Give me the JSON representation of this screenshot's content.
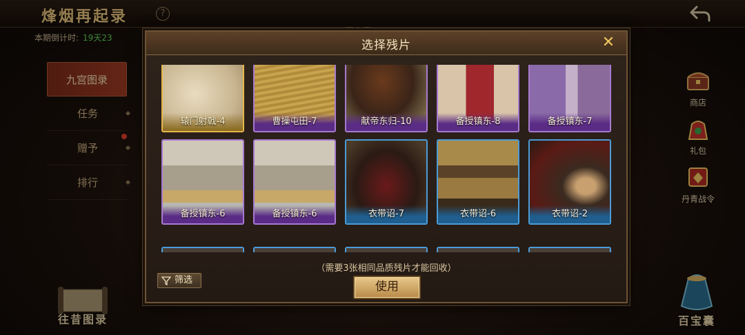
{
  "background": {
    "title": "烽烟再起录",
    "countdown_label": "本期倒计时:",
    "countdown_value": "19天23",
    "under_tab": "百宝囊",
    "nav": [
      {
        "label": "九宫图录",
        "active": true
      },
      {
        "label": "任务",
        "active": false
      },
      {
        "label": "赠予",
        "active": false,
        "notify": true
      },
      {
        "label": "排行",
        "active": false
      }
    ],
    "rail": [
      {
        "label": "商店",
        "icon": "shop-chest-icon"
      },
      {
        "label": "礼包",
        "icon": "gift-bag-icon"
      },
      {
        "label": "丹青战令",
        "icon": "battle-pass-icon"
      }
    ],
    "bottom_left_label": "往昔图录",
    "bottom_right_label": "百宝囊"
  },
  "modal": {
    "title": "选择残片",
    "close_icon": "close-icon",
    "cards": [
      {
        "label": "辕门射戟-4",
        "quality": "gold"
      },
      {
        "label": "曹操屯田-7",
        "quality": "purple"
      },
      {
        "label": "献帝东归-10",
        "quality": "purple"
      },
      {
        "label": "备授镇东-8",
        "quality": "purple"
      },
      {
        "label": "备授镇东-7",
        "quality": "purple"
      },
      {
        "label": "备授镇东-6",
        "quality": "purple"
      },
      {
        "label": "备授镇东-6",
        "quality": "purple"
      },
      {
        "label": "衣带诏-7",
        "quality": "blue"
      },
      {
        "label": "衣带诏-6",
        "quality": "blue"
      },
      {
        "label": "衣带诏-2",
        "quality": "blue"
      }
    ],
    "hint": "（需要3张相同品质残片才能回收）",
    "filter_label": "筛选",
    "use_label": "使用"
  },
  "colors": {
    "gold": "#e6b84a",
    "purple": "#a77ad0",
    "blue": "#4c9cd8"
  }
}
